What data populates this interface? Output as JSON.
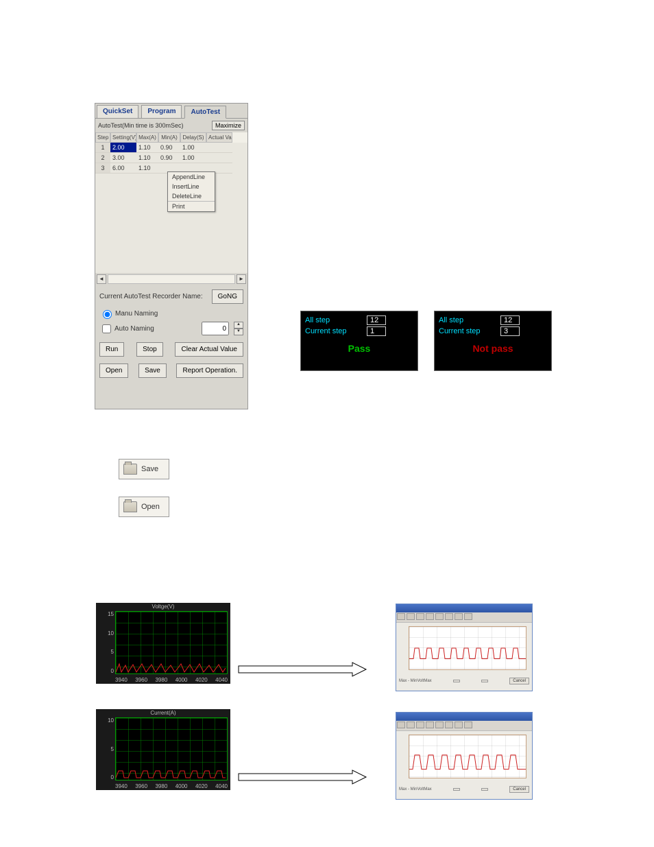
{
  "tabs": {
    "quickset": "QuickSet",
    "program": "Program",
    "autotest": "AutoTest"
  },
  "panel": {
    "title": "AutoTest(Min time is 300mSec)",
    "maximize": "Maximize",
    "columns": {
      "step": "Step",
      "setting": "Setting(V)",
      "max": "Max(A)",
      "min": "Min(A)",
      "delay": "Delay(S)",
      "actual": "Actual Va"
    },
    "rows": [
      {
        "step": "1",
        "setting": "2.00",
        "max": "1.10",
        "min": "0.90",
        "delay": "1.00",
        "actual": ""
      },
      {
        "step": "2",
        "setting": "3.00",
        "max": "1.10",
        "min": "0.90",
        "delay": "1.00",
        "actual": ""
      },
      {
        "step": "3",
        "setting": "6.00",
        "max": "1.10",
        "min": "",
        "delay": "",
        "actual": ""
      }
    ],
    "context_menu": {
      "append": "AppendLine",
      "insert": "InsertLine",
      "delete": "DeleteLine",
      "print": "Print"
    },
    "recorder_label": "Current AutoTest Recorder Name:",
    "gong": "GoNG",
    "manu_naming": "Manu Naming",
    "auto_naming": "Auto Naming",
    "auto_naming_value": "0",
    "run": "Run",
    "stop": "Stop",
    "clear": "Clear Actual Value",
    "open": "Open",
    "save": "Save",
    "report": "Report Operation."
  },
  "results": {
    "all_step_label": "All step",
    "current_step_label": "Current step",
    "pass": {
      "all": "12",
      "current": "1",
      "status": "Pass"
    },
    "notpass": {
      "all": "12",
      "current": "3",
      "status": "Not pass"
    }
  },
  "icon_buttons": {
    "save": "Save",
    "open": "Open"
  },
  "chart_data": [
    {
      "id": "voltage",
      "type": "line",
      "title": "Voltge(V)",
      "x": [
        3940,
        3960,
        3980,
        4000,
        4020,
        4040
      ],
      "y_ticks": [
        0.0,
        5.0,
        10.0,
        15.0
      ],
      "xlim": [
        3940,
        4040
      ],
      "ylim": [
        0,
        15
      ]
    },
    {
      "id": "current",
      "type": "line",
      "title": "Current(A)",
      "x": [
        3940,
        3960,
        3980,
        4000,
        4020,
        4040
      ],
      "y_ticks": [
        0,
        5,
        10
      ],
      "xlim": [
        3940,
        4040
      ],
      "ylim": [
        0,
        10
      ]
    }
  ],
  "preview": {
    "caption": "Max - MinVoltMax",
    "btn_cancel": "Cancel"
  }
}
